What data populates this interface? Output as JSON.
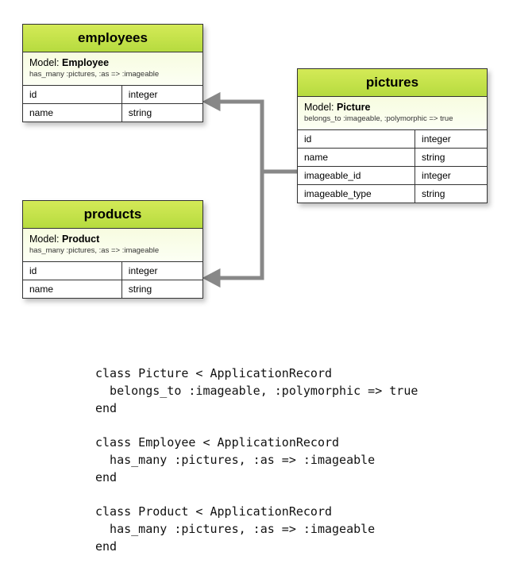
{
  "entities": {
    "employees": {
      "title": "employees",
      "model_label": "Model:",
      "model_name": "Employee",
      "assoc": "has_many :pictures, :as => :imageable",
      "fields": [
        {
          "name": "id",
          "type": "integer"
        },
        {
          "name": "name",
          "type": "string"
        }
      ]
    },
    "products": {
      "title": "products",
      "model_label": "Model:",
      "model_name": "Product",
      "assoc": "has_many :pictures, :as => :imageable",
      "fields": [
        {
          "name": "id",
          "type": "integer"
        },
        {
          "name": "name",
          "type": "string"
        }
      ]
    },
    "pictures": {
      "title": "pictures",
      "model_label": "Model:",
      "model_name": "Picture",
      "assoc": "belongs_to :imageable, :polymorphic => true",
      "fields": [
        {
          "name": "id",
          "type": "integer"
        },
        {
          "name": "name",
          "type": "string"
        },
        {
          "name": "imageable_id",
          "type": "integer"
        },
        {
          "name": "imageable_type",
          "type": "string"
        }
      ]
    }
  },
  "code": "class Picture < ApplicationRecord\n  belongs_to :imageable, :polymorphic => true\nend\n\nclass Employee < ApplicationRecord\n  has_many :pictures, :as => :imageable\nend\n\nclass Product < ApplicationRecord\n  has_many :pictures, :as => :imageable\nend"
}
